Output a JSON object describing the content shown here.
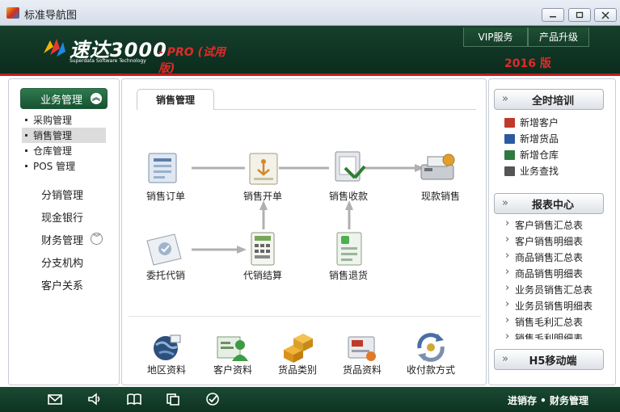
{
  "window": {
    "title": "标准导航图"
  },
  "header": {
    "logo_name": "速达3000",
    "logo_edition": "- PRO (试用版)",
    "logo_sub": "Superdata Software Technology",
    "vip_label": "VIP服务",
    "upgrade_label": "产品升级",
    "year_label": "2016 版"
  },
  "sidebar": {
    "active_section": "业务管理",
    "submenu": [
      {
        "label": "采购管理"
      },
      {
        "label": "销售管理"
      },
      {
        "label": "仓库管理"
      },
      {
        "label": "POS 管理"
      }
    ],
    "selected_submenu": "销售管理",
    "items": [
      {
        "label": "分销管理"
      },
      {
        "label": "现金银行"
      },
      {
        "label": "财务管理"
      },
      {
        "label": "分支机构"
      },
      {
        "label": "客户关系"
      }
    ]
  },
  "main": {
    "tab_label": "销售管理",
    "flow": [
      {
        "label": "销售订单",
        "icon": "sales-order-icon"
      },
      {
        "label": "销售开单",
        "icon": "sales-invoice-icon"
      },
      {
        "label": "销售收款",
        "icon": "sales-receipt-icon"
      },
      {
        "label": "现款销售",
        "icon": "cash-sales-icon"
      },
      {
        "label": "委托代销",
        "icon": "consignment-icon"
      },
      {
        "label": "代销结算",
        "icon": "consignment-settlement-icon"
      },
      {
        "label": "销售退货",
        "icon": "sales-return-icon"
      }
    ],
    "bottom": [
      {
        "label": "地区资料",
        "icon": "globe-icon"
      },
      {
        "label": "客户资料",
        "icon": "customer-icon"
      },
      {
        "label": "货品类别",
        "icon": "boxes-icon"
      },
      {
        "label": "货品资料",
        "icon": "goods-icon"
      },
      {
        "label": "收付款方式",
        "icon": "payment-method-icon"
      }
    ]
  },
  "right": {
    "training_title": "全时培训",
    "training_links": [
      {
        "label": "新增客户",
        "color": "#c0392b"
      },
      {
        "label": "新增货品",
        "color": "#2c5aa0"
      },
      {
        "label": "新增仓库",
        "color": "#2f7a3f"
      },
      {
        "label": "业务查找",
        "color": "#555555"
      }
    ],
    "report_title": "报表中心",
    "reports": [
      {
        "label": "客户销售汇总表"
      },
      {
        "label": "客户销售明细表"
      },
      {
        "label": "商品销售汇总表"
      },
      {
        "label": "商品销售明细表"
      },
      {
        "label": "业务员销售汇总表"
      },
      {
        "label": "业务员销售明细表"
      },
      {
        "label": "销售毛利汇总表"
      },
      {
        "label": "销售毛利明细表"
      }
    ],
    "mobile_title": "H5移动端"
  },
  "statusbar": {
    "icons": [
      "mail-icon",
      "speaker-icon",
      "book-icon",
      "copy-icon",
      "check-icon"
    ],
    "text": "进销存 • 财务管理"
  },
  "colors": {
    "header_green": "#0f3322",
    "accent_red": "#e02a2a",
    "active_green": "#236b43"
  }
}
